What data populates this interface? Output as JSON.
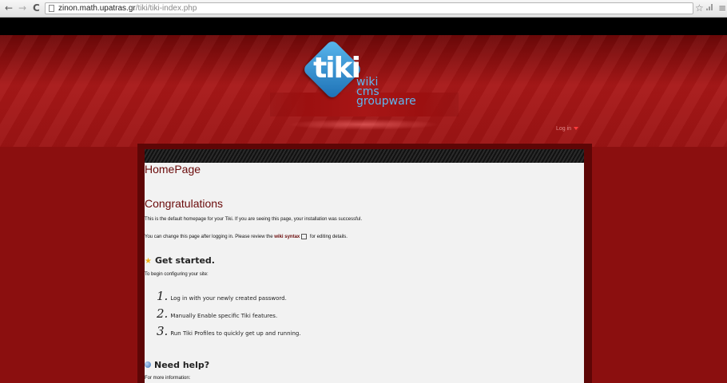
{
  "browser": {
    "back_icon": "←",
    "forward_icon": "→",
    "reload_icon": "C",
    "url_host": "zinon.math.upatras.gr",
    "url_path": "/tiki/tiki-index.php",
    "star_icon": "☆",
    "menu_icon": "≡"
  },
  "header": {
    "logo_text": "tiki",
    "logo_tagline": [
      "wiki",
      "cms",
      "groupware"
    ],
    "login_label": "Log in"
  },
  "content": {
    "page_title": "HomePage",
    "heading": "Congratulations",
    "intro": "This is the default homepage for your Tiki. If you are seeing this page, your installation was successful.",
    "change_before": "You can change this page after logging in. Please review the",
    "wiki_syntax_link": "wiki syntax",
    "change_after": "for editing details.",
    "get_started_heading": "Get started.",
    "get_started_intro": "To begin configuring your site:",
    "steps": [
      {
        "num": "1.",
        "text": "Log in with your newly created password."
      },
      {
        "num": "2.",
        "text": "Manually Enable specific Tiki features."
      },
      {
        "num": "3.",
        "text": "Run Tiki Profiles to quickly get up and running."
      }
    ],
    "need_help_heading": "Need help?",
    "more_info": "For more information:"
  },
  "colors": {
    "header_red": "#9c1414",
    "heading_text": "#6a0a0a",
    "logo_blue": "#2a86cc"
  }
}
